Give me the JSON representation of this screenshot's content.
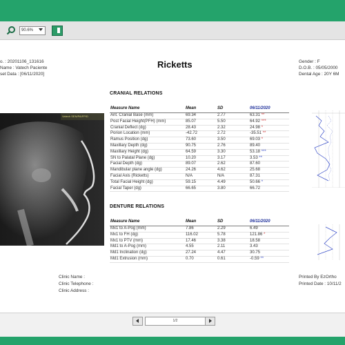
{
  "toolbar": {
    "zoom_value": "90.6%"
  },
  "report": {
    "title": "Ricketts",
    "patient_id": "o. : 20201106_131616",
    "patient_name": "Name : Vatech Paciente",
    "asset_date": "set Data : [06/11/2020]",
    "gender": "Gender : F",
    "dob": "D.O.B. : 05/05/2000",
    "dental_age": "Dental Age : 20Y 6M"
  },
  "xray": {
    "label": "Vatech SEN/PA/FP/D"
  },
  "cranial": {
    "heading": "CRANIAL RELATIONS",
    "headers": [
      "Measure Name",
      "Mean",
      "SD",
      "06/11/2020"
    ],
    "rows": [
      {
        "name": "Ant. Cranial Base (mm)",
        "mean": "69.34",
        "sd": "2.77",
        "val": "63.31",
        "star": "**",
        "starColor": "red"
      },
      {
        "name": "Post Facial Height(PFH) (mm)",
        "mean": "85.07",
        "sd": "5.50",
        "val": "64.92",
        "star": "***",
        "starColor": "red"
      },
      {
        "name": "Cranial Deflect (dg)",
        "mean": "28.43",
        "sd": "2.32",
        "val": "24.98",
        "star": "*",
        "starColor": "red"
      },
      {
        "name": "Porion Location (mm)",
        "mean": "-42.72",
        "sd": "2.72",
        "val": "-35.51",
        "star": "**",
        "starColor": "red"
      },
      {
        "name": "Ramus Position (dg)",
        "mean": "73.60",
        "sd": "3.50",
        "val": "69.03",
        "star": "*",
        "starColor": "red"
      },
      {
        "name": "Maxillary Depth (dg)",
        "mean": "90.75",
        "sd": "2.76",
        "val": "89.40",
        "star": "",
        "starColor": "red"
      },
      {
        "name": "Maxillary Height (dg)",
        "mean": "64.59",
        "sd": "3.30",
        "val": "53.18",
        "star": "***",
        "starColor": "blue"
      },
      {
        "name": "SN to Palatal Plane (dg)",
        "mean": "10.20",
        "sd": "3.17",
        "val": "3.53",
        "star": "**",
        "starColor": "blue"
      },
      {
        "name": "Facial Depth (dg)",
        "mean": "89.07",
        "sd": "2.62",
        "val": "87.60",
        "star": "",
        "starColor": "red"
      },
      {
        "name": "Mandibular plane angle (dg)",
        "mean": "24.26",
        "sd": "4.62",
        "val": "25.68",
        "star": "",
        "starColor": "red"
      },
      {
        "name": "Facial Axis (Ricketts)",
        "mean": "N/A",
        "sd": "N/A",
        "val": "87.31",
        "star": "",
        "starColor": "red"
      },
      {
        "name": "Total Facial Height (dg)",
        "mean": "59.15",
        "sd": "4.49",
        "val": "50.66",
        "star": "*",
        "starColor": "blue"
      },
      {
        "name": "Facial Taper (dg)",
        "mean": "66.65",
        "sd": "3.80",
        "val": "66.72",
        "star": "",
        "starColor": "red"
      }
    ]
  },
  "denture": {
    "heading": "DENTURE RELATIONS",
    "headers": [
      "Measure Name",
      "Mean",
      "SD",
      "06/11/2020"
    ],
    "rows": [
      {
        "name": "Mx1 to A-Pog (mm)",
        "mean": "7.86",
        "sd": "2.29",
        "val": "6.49",
        "star": "",
        "starColor": "red"
      },
      {
        "name": "Mx1 to FH (dg)",
        "mean": "116.02",
        "sd": "5.78",
        "val": "121.86",
        "star": "*",
        "starColor": "red"
      },
      {
        "name": "Mx1 to PTV (mm)",
        "mean": "17.46",
        "sd": "3.38",
        "val": "18.58",
        "star": "",
        "starColor": "red"
      },
      {
        "name": "Md1 to A-Pog (mm)",
        "mean": "4.55",
        "sd": "2.11",
        "val": "3.43",
        "star": "",
        "starColor": "red"
      },
      {
        "name": "Md1 Inclination (dg)",
        "mean": "27.24",
        "sd": "4.47",
        "val": "30.75",
        "star": "",
        "starColor": "red"
      },
      {
        "name": "Md1 Extrusion (mm)",
        "mean": "0.70",
        "sd": "0.61",
        "val": "-0.59",
        "star": "**",
        "starColor": "blue"
      }
    ]
  },
  "footer": {
    "clinic_name": "Clinic Name :",
    "clinic_telephone": "Clinic Telephone :",
    "clinic_address": "Clinic Address :",
    "printed_by": "Printed By EzOrtho",
    "printed_date": "Printed Date : 10/11/2"
  },
  "pager": {
    "page_text": "1/2"
  },
  "colors": {
    "brand_green": "#24a36b",
    "date_blue": "#1d2e9a",
    "star_red": "#d23c3c",
    "star_blue": "#3a4fc9"
  }
}
